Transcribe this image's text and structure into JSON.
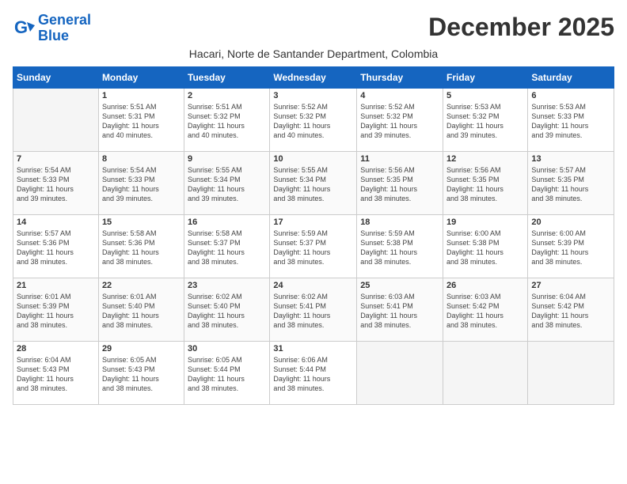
{
  "header": {
    "logo_line1": "General",
    "logo_line2": "Blue",
    "month_title": "December 2025",
    "location": "Hacari, Norte de Santander Department, Colombia"
  },
  "weekdays": [
    "Sunday",
    "Monday",
    "Tuesday",
    "Wednesday",
    "Thursday",
    "Friday",
    "Saturday"
  ],
  "weeks": [
    [
      {
        "day": "",
        "info": ""
      },
      {
        "day": "1",
        "info": "Sunrise: 5:51 AM\nSunset: 5:31 PM\nDaylight: 11 hours\nand 40 minutes."
      },
      {
        "day": "2",
        "info": "Sunrise: 5:51 AM\nSunset: 5:32 PM\nDaylight: 11 hours\nand 40 minutes."
      },
      {
        "day": "3",
        "info": "Sunrise: 5:52 AM\nSunset: 5:32 PM\nDaylight: 11 hours\nand 40 minutes."
      },
      {
        "day": "4",
        "info": "Sunrise: 5:52 AM\nSunset: 5:32 PM\nDaylight: 11 hours\nand 39 minutes."
      },
      {
        "day": "5",
        "info": "Sunrise: 5:53 AM\nSunset: 5:32 PM\nDaylight: 11 hours\nand 39 minutes."
      },
      {
        "day": "6",
        "info": "Sunrise: 5:53 AM\nSunset: 5:33 PM\nDaylight: 11 hours\nand 39 minutes."
      }
    ],
    [
      {
        "day": "7",
        "info": "Sunrise: 5:54 AM\nSunset: 5:33 PM\nDaylight: 11 hours\nand 39 minutes."
      },
      {
        "day": "8",
        "info": "Sunrise: 5:54 AM\nSunset: 5:33 PM\nDaylight: 11 hours\nand 39 minutes."
      },
      {
        "day": "9",
        "info": "Sunrise: 5:55 AM\nSunset: 5:34 PM\nDaylight: 11 hours\nand 39 minutes."
      },
      {
        "day": "10",
        "info": "Sunrise: 5:55 AM\nSunset: 5:34 PM\nDaylight: 11 hours\nand 38 minutes."
      },
      {
        "day": "11",
        "info": "Sunrise: 5:56 AM\nSunset: 5:35 PM\nDaylight: 11 hours\nand 38 minutes."
      },
      {
        "day": "12",
        "info": "Sunrise: 5:56 AM\nSunset: 5:35 PM\nDaylight: 11 hours\nand 38 minutes."
      },
      {
        "day": "13",
        "info": "Sunrise: 5:57 AM\nSunset: 5:35 PM\nDaylight: 11 hours\nand 38 minutes."
      }
    ],
    [
      {
        "day": "14",
        "info": "Sunrise: 5:57 AM\nSunset: 5:36 PM\nDaylight: 11 hours\nand 38 minutes."
      },
      {
        "day": "15",
        "info": "Sunrise: 5:58 AM\nSunset: 5:36 PM\nDaylight: 11 hours\nand 38 minutes."
      },
      {
        "day": "16",
        "info": "Sunrise: 5:58 AM\nSunset: 5:37 PM\nDaylight: 11 hours\nand 38 minutes."
      },
      {
        "day": "17",
        "info": "Sunrise: 5:59 AM\nSunset: 5:37 PM\nDaylight: 11 hours\nand 38 minutes."
      },
      {
        "day": "18",
        "info": "Sunrise: 5:59 AM\nSunset: 5:38 PM\nDaylight: 11 hours\nand 38 minutes."
      },
      {
        "day": "19",
        "info": "Sunrise: 6:00 AM\nSunset: 5:38 PM\nDaylight: 11 hours\nand 38 minutes."
      },
      {
        "day": "20",
        "info": "Sunrise: 6:00 AM\nSunset: 5:39 PM\nDaylight: 11 hours\nand 38 minutes."
      }
    ],
    [
      {
        "day": "21",
        "info": "Sunrise: 6:01 AM\nSunset: 5:39 PM\nDaylight: 11 hours\nand 38 minutes."
      },
      {
        "day": "22",
        "info": "Sunrise: 6:01 AM\nSunset: 5:40 PM\nDaylight: 11 hours\nand 38 minutes."
      },
      {
        "day": "23",
        "info": "Sunrise: 6:02 AM\nSunset: 5:40 PM\nDaylight: 11 hours\nand 38 minutes."
      },
      {
        "day": "24",
        "info": "Sunrise: 6:02 AM\nSunset: 5:41 PM\nDaylight: 11 hours\nand 38 minutes."
      },
      {
        "day": "25",
        "info": "Sunrise: 6:03 AM\nSunset: 5:41 PM\nDaylight: 11 hours\nand 38 minutes."
      },
      {
        "day": "26",
        "info": "Sunrise: 6:03 AM\nSunset: 5:42 PM\nDaylight: 11 hours\nand 38 minutes."
      },
      {
        "day": "27",
        "info": "Sunrise: 6:04 AM\nSunset: 5:42 PM\nDaylight: 11 hours\nand 38 minutes."
      }
    ],
    [
      {
        "day": "28",
        "info": "Sunrise: 6:04 AM\nSunset: 5:43 PM\nDaylight: 11 hours\nand 38 minutes."
      },
      {
        "day": "29",
        "info": "Sunrise: 6:05 AM\nSunset: 5:43 PM\nDaylight: 11 hours\nand 38 minutes."
      },
      {
        "day": "30",
        "info": "Sunrise: 6:05 AM\nSunset: 5:44 PM\nDaylight: 11 hours\nand 38 minutes."
      },
      {
        "day": "31",
        "info": "Sunrise: 6:06 AM\nSunset: 5:44 PM\nDaylight: 11 hours\nand 38 minutes."
      },
      {
        "day": "",
        "info": ""
      },
      {
        "day": "",
        "info": ""
      },
      {
        "day": "",
        "info": ""
      }
    ]
  ]
}
